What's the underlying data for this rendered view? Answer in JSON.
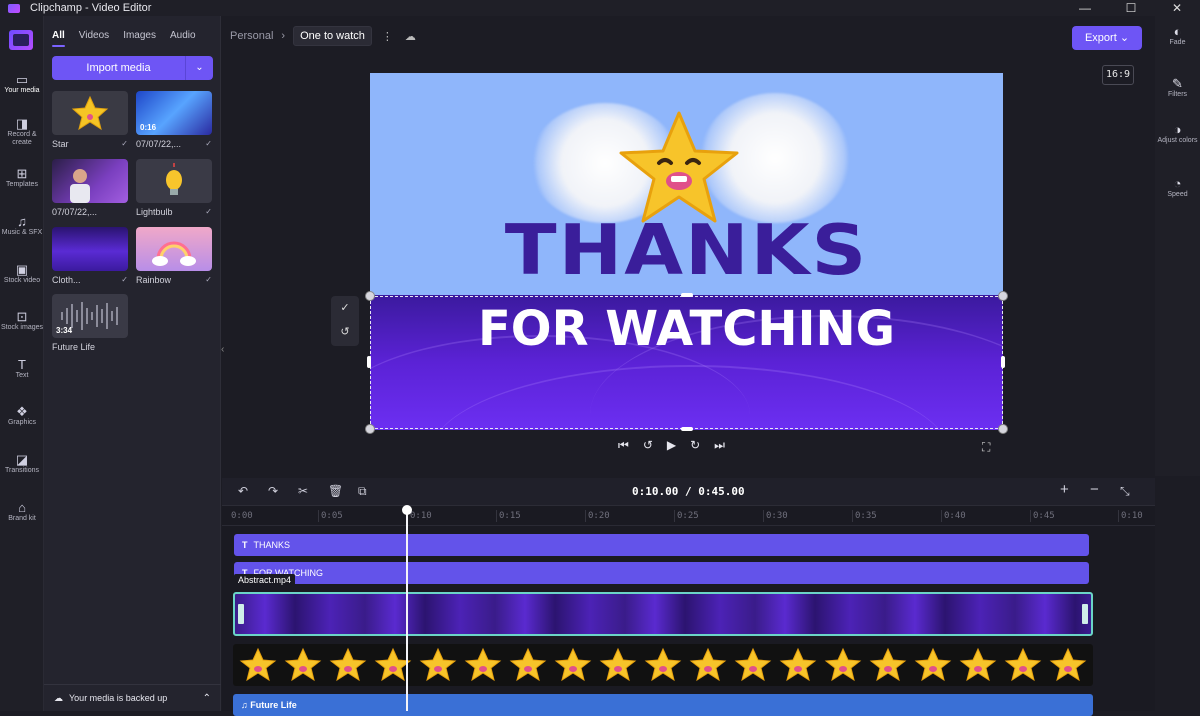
{
  "window": {
    "title": "Clipchamp - Video Editor",
    "controls": [
      "—",
      "☐",
      "✕"
    ]
  },
  "left_rail": {
    "items": [
      {
        "icon": "folder-icon",
        "glyph": "▭",
        "label": "Your media"
      },
      {
        "icon": "camera-icon",
        "glyph": "◨",
        "label": "Record & create"
      },
      {
        "icon": "templates-icon",
        "glyph": "⊞",
        "label": "Templates"
      },
      {
        "icon": "music-icon",
        "glyph": "♫",
        "label": "Music & SFX"
      },
      {
        "icon": "stock-video-icon",
        "glyph": "▣",
        "label": "Stock video"
      },
      {
        "icon": "stock-images-icon",
        "glyph": "⊡",
        "label": "Stock images"
      },
      {
        "icon": "text-icon",
        "glyph": "T",
        "label": "Text"
      },
      {
        "icon": "graphics-icon",
        "glyph": "❖",
        "label": "Graphics"
      },
      {
        "icon": "transitions-icon",
        "glyph": "◪",
        "label": "Transitions"
      },
      {
        "icon": "brand-kit-icon",
        "glyph": "⌂",
        "label": "Brand kit"
      }
    ]
  },
  "media_panel": {
    "tabs": [
      "All",
      "Videos",
      "Images",
      "Audio"
    ],
    "active_tab": "All",
    "import_label": "Import media",
    "items": [
      {
        "label": "Star",
        "duration": "",
        "checked": true
      },
      {
        "label": "07/07/22,...",
        "duration": "0:16",
        "checked": true
      },
      {
        "label": "07/07/22,...",
        "duration": "",
        "checked": false
      },
      {
        "label": "Lightbulb",
        "duration": "",
        "checked": true
      },
      {
        "label": "Cloth...",
        "duration": "",
        "checked": true
      },
      {
        "label": "Rainbow",
        "duration": "",
        "checked": true
      },
      {
        "label": "Future Life",
        "duration": "3:34",
        "checked": false
      }
    ],
    "backup_text": "Your media is backed up"
  },
  "topbar": {
    "breadcrumb": "Personal",
    "project_name": "One to watch",
    "export_label": "Export",
    "aspect_ratio": "16:9"
  },
  "right_rail": {
    "items": [
      {
        "icon": "fade-icon",
        "glyph": "◐",
        "label": "Fade"
      },
      {
        "icon": "filters-icon",
        "glyph": "✎",
        "label": "Filters"
      },
      {
        "icon": "adjust-colors-icon",
        "glyph": "◑",
        "label": "Adjust colors"
      },
      {
        "icon": "speed-icon",
        "glyph": "◔",
        "label": "Speed"
      }
    ]
  },
  "preview": {
    "text_top": "THANKS",
    "text_bottom": "FOR WATCHING"
  },
  "timeline": {
    "current_time": "0:10.00",
    "total_time": "0:45.00",
    "ticks": [
      "0:00",
      "0:05",
      "0:10",
      "0:15",
      "0:20",
      "0:25",
      "0:30",
      "0:35",
      "0:40",
      "0:45",
      "0:10"
    ],
    "tracks": {
      "text1": "THANKS",
      "text2": "FOR WATCHING",
      "video_label": "Abstract.mp4",
      "audio": "Future Life"
    }
  }
}
